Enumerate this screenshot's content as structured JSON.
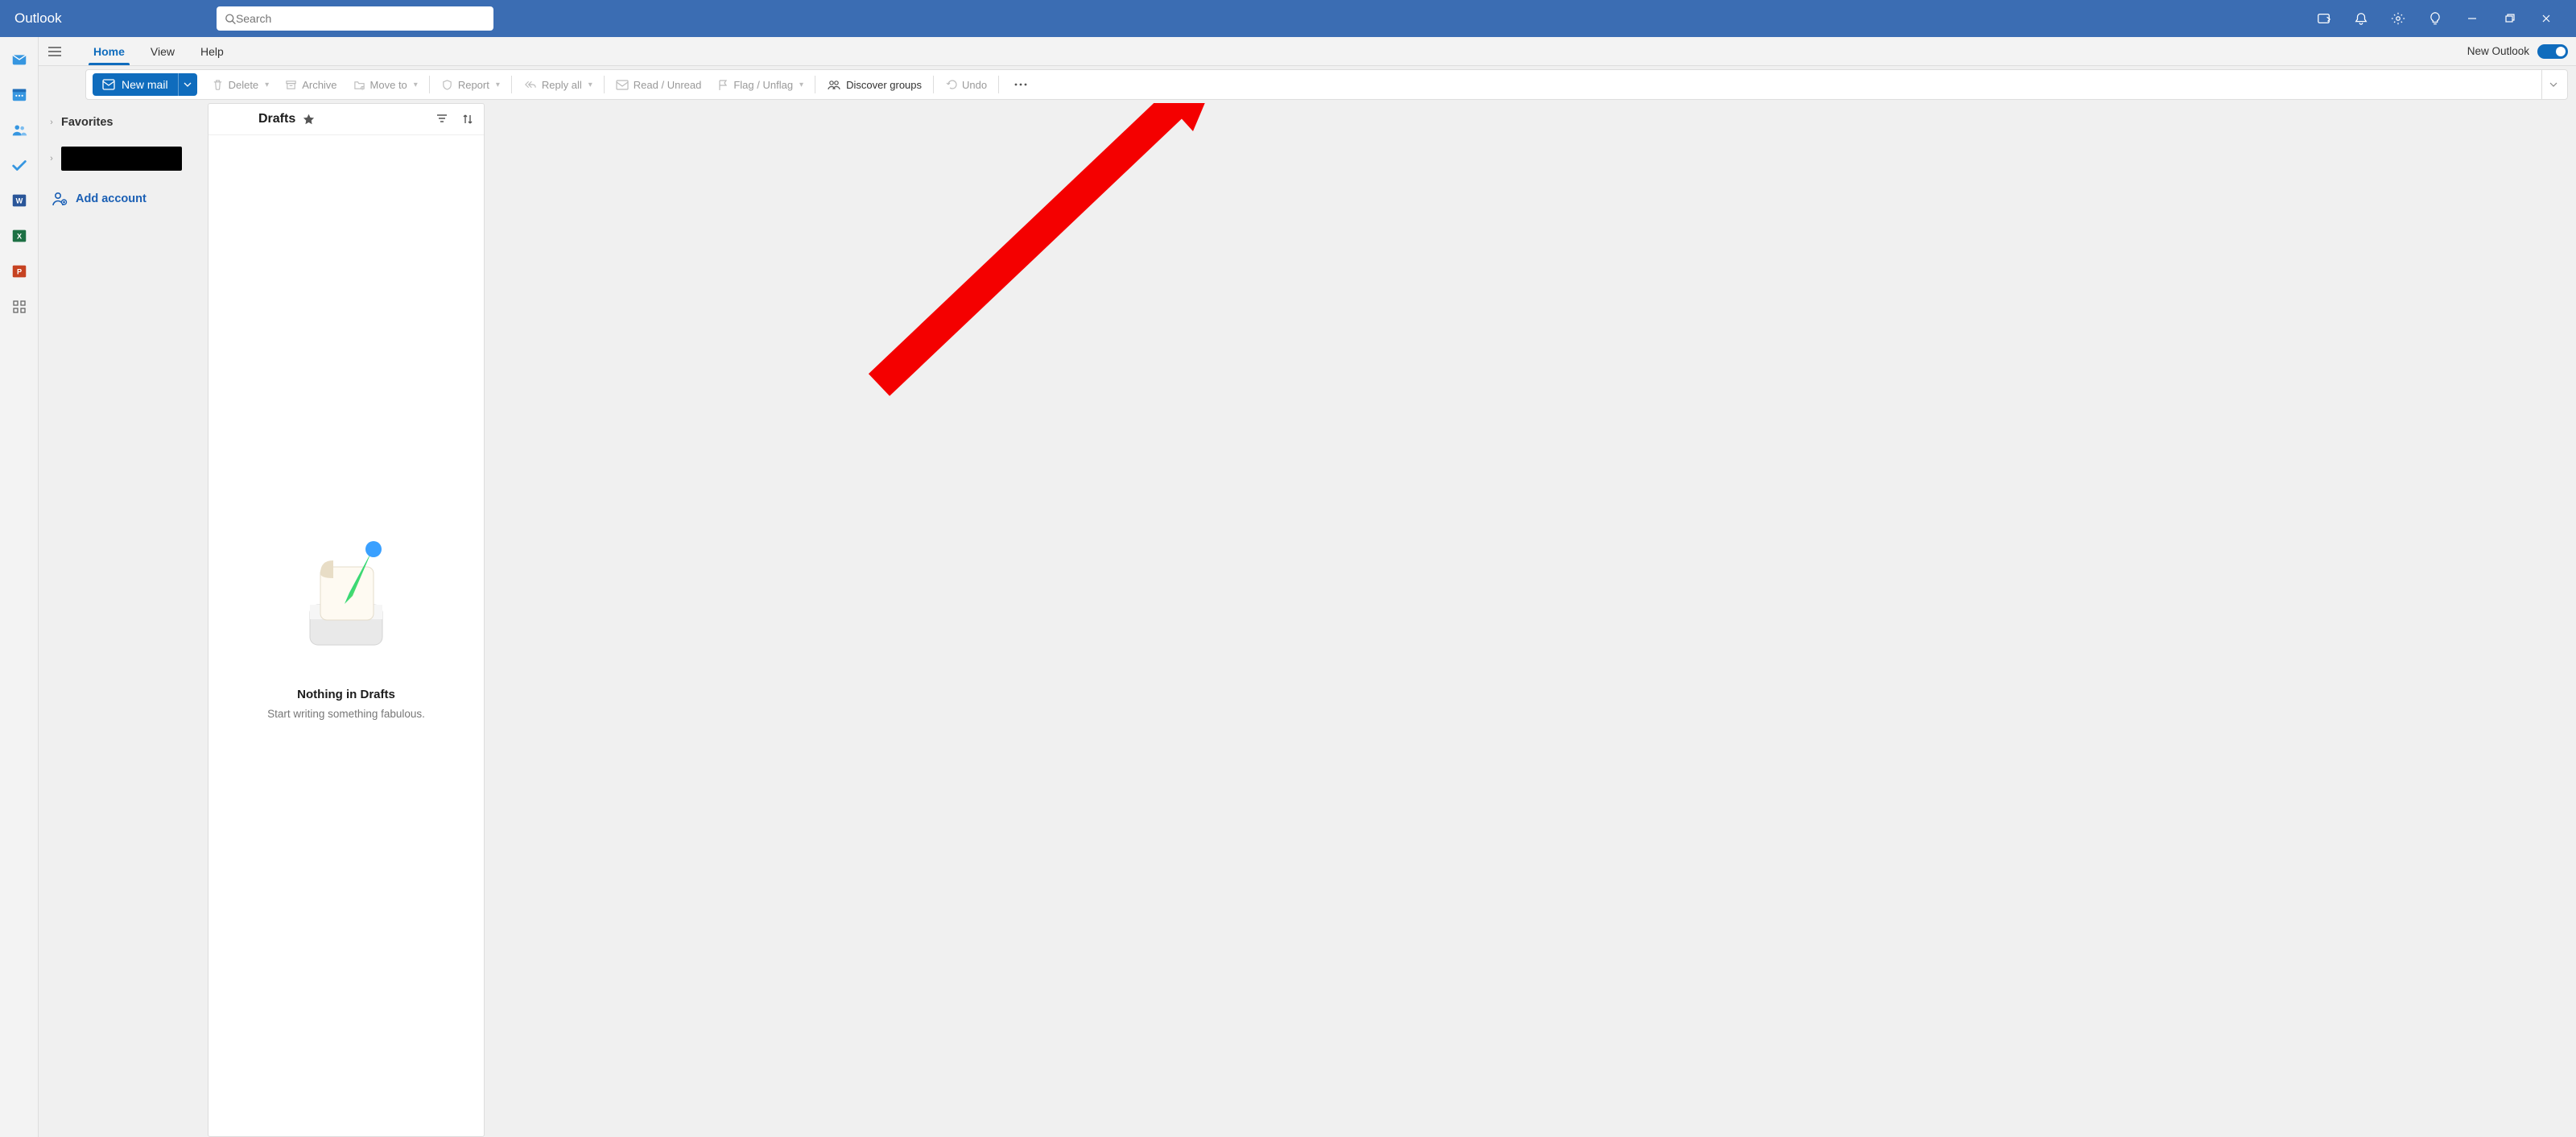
{
  "app": {
    "name": "Outlook"
  },
  "search": {
    "placeholder": "Search"
  },
  "tabs": {
    "home": "Home",
    "view": "View",
    "help": "Help"
  },
  "menubar": {
    "new_outlook_label": "New Outlook"
  },
  "toolbar": {
    "new_mail": "New mail",
    "delete": "Delete",
    "archive": "Archive",
    "move_to": "Move to",
    "report": "Report",
    "reply_all": "Reply all",
    "read_unread": "Read / Unread",
    "flag_unflag": "Flag / Unflag",
    "discover_groups": "Discover groups",
    "undo": "Undo"
  },
  "folder_pane": {
    "favorites": "Favorites",
    "add_account": "Add account"
  },
  "msglist": {
    "title": "Drafts",
    "empty_heading": "Nothing in Drafts",
    "empty_sub": "Start writing something fabulous."
  }
}
